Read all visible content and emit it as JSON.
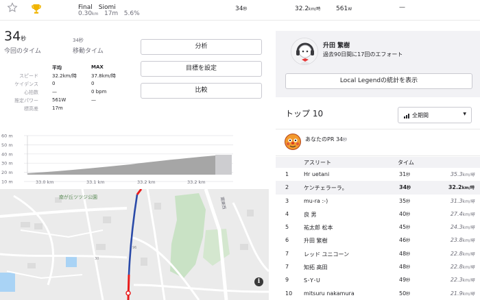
{
  "segment_row": {
    "name": "Final　Siomi",
    "distance": "0.30",
    "distance_unit": "km",
    "elevation_gain": "17m",
    "grade": "5.6%",
    "time": "34",
    "time_unit": "秒",
    "speed": "32.2",
    "speed_unit": "km/時",
    "power": "561",
    "power_unit": "W",
    "extra": "—"
  },
  "summary": {
    "elapsed_time": "34",
    "elapsed_unit": "秒",
    "elapsed_label": "今回のタイム",
    "moving_time": "34秒",
    "moving_label": "移動タイム"
  },
  "stats": {
    "header_avg": "平均",
    "header_max": "MAX",
    "rows": [
      {
        "label": "スピード",
        "avg": "32.2km/時",
        "max": "37.8km/時"
      },
      {
        "label": "ケイデンス",
        "avg": "0",
        "max": "0"
      },
      {
        "label": "心拍数",
        "avg": "—",
        "max": "0 bpm"
      },
      {
        "label": "推定パワー",
        "avg": "561W",
        "max": "—"
      },
      {
        "label": "標高差",
        "avg": "17m",
        "max": ""
      }
    ]
  },
  "buttons": {
    "analysis": "分析",
    "set_goal": "目標を設定",
    "compare": "比較"
  },
  "elevation_chart": {
    "y_ticks": [
      "60 m",
      "50 m",
      "40 m",
      "30 m",
      "20 m",
      "10 m"
    ],
    "x_ticks": [
      "33.0 km",
      "33.1 km",
      "33.2 km",
      "33.2 km"
    ]
  },
  "map": {
    "place_label": "南が丘ツツジ公園",
    "road_label": "園東西",
    "small_label_1": "96",
    "small_label_2": "30",
    "info_glyph": "i"
  },
  "profile": {
    "name": "升田 繁樹",
    "effort_text": "過去90日間に17回のエフォート",
    "local_legend_button": "Local Legendの統計を表示"
  },
  "leaderboard": {
    "title": "トップ 10",
    "filter_value": "全期間",
    "pr_label": "あなたのPR",
    "pr_time": "34",
    "pr_unit": "秒",
    "col_athlete": "アスリート",
    "col_time": "タイム",
    "time_unit": "秒",
    "speed_unit": "km/時",
    "rows": [
      {
        "rank": "1",
        "name": "Hr uetani",
        "time": "31",
        "speed": "35.3"
      },
      {
        "rank": "2",
        "name": "ケンチェラーラ。",
        "time": "34",
        "speed": "32.2",
        "me": true
      },
      {
        "rank": "3",
        "name": "mu-ra :-)",
        "time": "35",
        "speed": "31.3"
      },
      {
        "rank": "4",
        "name": "良 男",
        "time": "40",
        "speed": "27.4"
      },
      {
        "rank": "5",
        "name": "祐太郎 松本",
        "time": "45",
        "speed": "24.3"
      },
      {
        "rank": "6",
        "name": "升田 繁樹",
        "time": "46",
        "speed": "23.8"
      },
      {
        "rank": "7",
        "name": "レッド ユニコーン",
        "time": "48",
        "speed": "22.8"
      },
      {
        "rank": "7",
        "name": "知拓 高田",
        "time": "48",
        "speed": "22.8"
      },
      {
        "rank": "9",
        "name": "S･Y･U",
        "time": "49",
        "speed": "22.3"
      },
      {
        "rank": "10",
        "name": "mitsuru nakamura",
        "time": "50",
        "speed": "21.9"
      }
    ]
  },
  "colors": {
    "trophy": "#f0b400",
    "route_red": "#e81c1c",
    "route_blue": "#2a4aa8",
    "elevation_fill": "#a6a6a6",
    "panel_gray": "#f2f2f5"
  }
}
